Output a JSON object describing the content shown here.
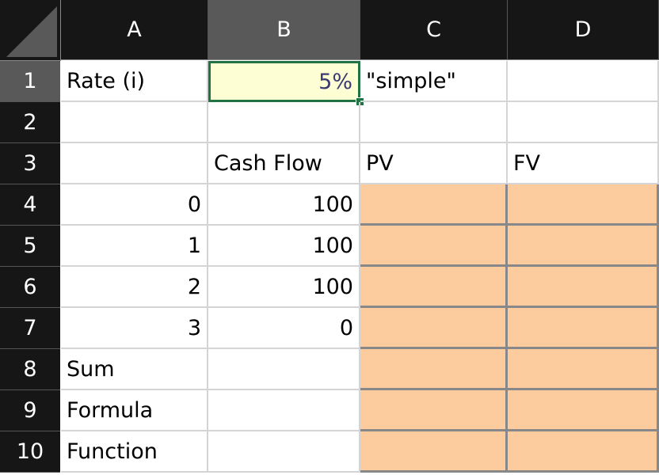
{
  "columns": [
    "A",
    "B",
    "C",
    "D"
  ],
  "selected_column": "B",
  "rows": [
    "1",
    "2",
    "3",
    "4",
    "5",
    "6",
    "7",
    "8",
    "9",
    "10"
  ],
  "selected_row": "1",
  "cells": {
    "A1": "Rate (i)",
    "B1": "5%",
    "C1": "\"simple\"",
    "D1": "",
    "A2": "",
    "B2": "",
    "C2": "",
    "D2": "",
    "A3": "",
    "B3": "Cash Flow",
    "C3": "PV",
    "D3": "FV",
    "A4": "0",
    "B4": "100",
    "C4": "",
    "D4": "",
    "A5": "1",
    "B5": "100",
    "C5": "",
    "D5": "",
    "A6": "2",
    "B6": "100",
    "C6": "",
    "D6": "",
    "A7": "3",
    "B7": "0",
    "C7": "",
    "D7": "",
    "A8": "Sum",
    "B8": "",
    "C8": "",
    "D8": "",
    "A9": "Formula",
    "B9": "",
    "C9": "",
    "D9": "",
    "A10": "Function",
    "B10": "",
    "C10": "",
    "D10": ""
  },
  "active_cell": "B1",
  "colors": {
    "header_bg": "#161616",
    "header_selected_bg": "#595959",
    "active_cell_fill": "#fefed4",
    "active_border": "#217346",
    "input_fill": "#fccc9e",
    "rate_text": "#3a3a72"
  }
}
